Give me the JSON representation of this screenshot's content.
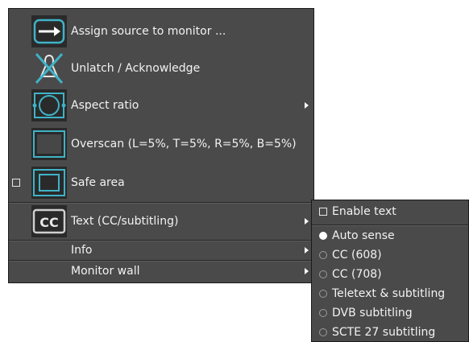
{
  "menu": {
    "items": [
      {
        "label": "Assign source to monitor ..."
      },
      {
        "label": "Unlatch / Acknowledge"
      },
      {
        "label": "Aspect ratio"
      },
      {
        "label": "Overscan (L=5%, T=5%, R=5%, B=5%)"
      },
      {
        "label": "Safe area"
      },
      {
        "label": "Text (CC/subtitling)"
      },
      {
        "label": "Info"
      },
      {
        "label": "Monitor wall"
      }
    ]
  },
  "submenu": {
    "enable_text": "Enable text",
    "options": [
      "Auto sense",
      "CC (608)",
      "CC (708)",
      "Teletext & subtitling",
      "DVB subtitling",
      "SCTE 27 subtitling"
    ],
    "selected": "Auto sense"
  },
  "colors": {
    "menu_bg": "#4a4a4a",
    "icon_accent": "#3fb3c8",
    "text": "#f2f2f2"
  }
}
